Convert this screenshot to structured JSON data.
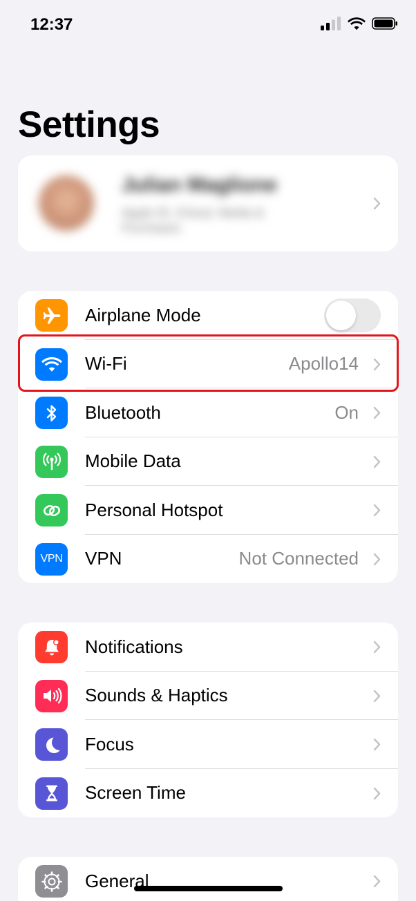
{
  "status": {
    "time": "12:37"
  },
  "title": "Settings",
  "profile": {
    "name": "Julian Maglione",
    "subtitle": "Apple ID, iCloud, Media & Purchases"
  },
  "group1": [
    {
      "name": "airplane-mode",
      "label": "Airplane Mode",
      "icon": "airplane-icon",
      "color": "#ff9500",
      "toggle": false
    },
    {
      "name": "wifi",
      "label": "Wi-Fi",
      "value": "Apollo14",
      "icon": "wifi-icon",
      "color": "#007aff"
    },
    {
      "name": "bluetooth",
      "label": "Bluetooth",
      "value": "On",
      "icon": "bluetooth-icon",
      "color": "#007aff"
    },
    {
      "name": "mobile-data",
      "label": "Mobile Data",
      "icon": "antenna-icon",
      "color": "#34c759"
    },
    {
      "name": "personal-hotspot",
      "label": "Personal Hotspot",
      "icon": "hotspot-icon",
      "color": "#34c759"
    },
    {
      "name": "vpn",
      "label": "VPN",
      "value": "Not Connected",
      "icon": "vpn-icon",
      "icon_text": "VPN",
      "color": "#007aff"
    }
  ],
  "group2": [
    {
      "name": "notifications",
      "label": "Notifications",
      "icon": "bell-icon",
      "color": "#ff3b30"
    },
    {
      "name": "sounds-haptics",
      "label": "Sounds & Haptics",
      "icon": "speaker-icon",
      "color": "#ff2d55"
    },
    {
      "name": "focus",
      "label": "Focus",
      "icon": "moon-icon",
      "color": "#5856d6"
    },
    {
      "name": "screen-time",
      "label": "Screen Time",
      "icon": "hourglass-icon",
      "color": "#5856d6"
    }
  ],
  "group3": [
    {
      "name": "general",
      "label": "General",
      "icon": "gear-icon",
      "color": "#8e8e93"
    }
  ]
}
